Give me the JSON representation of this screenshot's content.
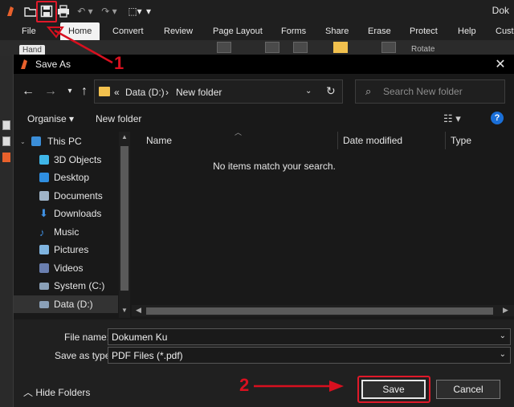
{
  "app": {
    "title": "Dok",
    "tabs": [
      "File",
      "Home",
      "Convert",
      "Review",
      "Page Layout",
      "Forms",
      "Share",
      "Erase",
      "Protect",
      "Help",
      "Cust"
    ],
    "active_tab": "Home",
    "ribbon": {
      "hand_label": "Hand",
      "rotate_label": "Rotate"
    }
  },
  "dialog": {
    "title": "Save As",
    "close_glyph": "✕",
    "breadcrumb": {
      "prefix": "«",
      "drive": "Data (D:)",
      "separator": "›",
      "folder": "New folder"
    },
    "search_placeholder": "Search New folder",
    "toolbar": {
      "organise": "Organise ▾",
      "new_folder": "New folder",
      "help": "?"
    },
    "tree": [
      {
        "label": "This PC",
        "icon": "computer-icon",
        "color": "#3b8ed8"
      },
      {
        "label": "3D Objects",
        "icon": "cube-icon",
        "color": "#3fb6e8"
      },
      {
        "label": "Desktop",
        "icon": "desktop-icon",
        "color": "#2f8ee0"
      },
      {
        "label": "Documents",
        "icon": "documents-icon",
        "color": "#9fb4c8"
      },
      {
        "label": "Downloads",
        "icon": "download-icon",
        "color": "#3f8fe0"
      },
      {
        "label": "Music",
        "icon": "music-icon",
        "color": "#3f8fe0"
      },
      {
        "label": "Pictures",
        "icon": "pictures-icon",
        "color": "#7fb4e0"
      },
      {
        "label": "Videos",
        "icon": "videos-icon",
        "color": "#6a7fb0"
      },
      {
        "label": "System (C:)",
        "icon": "drive-icon",
        "color": "#8aa0b8"
      },
      {
        "label": "Data (D:)",
        "icon": "drive-icon",
        "color": "#8aa0b8"
      }
    ],
    "selected_tree_item": "Data (D:)",
    "columns": [
      "Name",
      "Date modified",
      "Type"
    ],
    "empty_message": "No items match your search.",
    "file_name_label": "File name:",
    "file_name_value": "Dokumen Ku",
    "save_type_label": "Save as type:",
    "save_type_value": "PDF Files (*.pdf)",
    "hide_folders": "Hide Folders",
    "save_button": "Save",
    "cancel_button": "Cancel"
  },
  "annotations": {
    "step1": "1",
    "step2": "2",
    "color": "#d8101f"
  }
}
